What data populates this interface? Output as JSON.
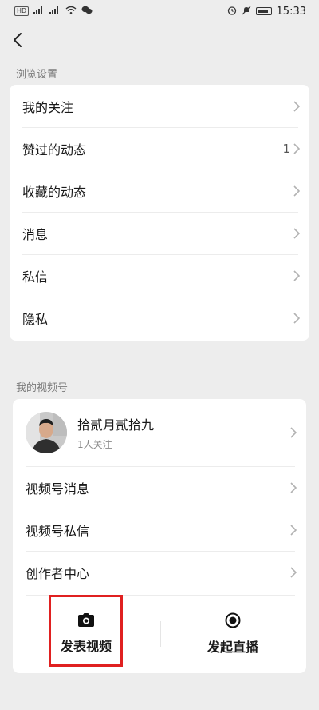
{
  "status_bar": {
    "left_badges": [
      "HD",
      "4G",
      "5G"
    ],
    "time": "15:33"
  },
  "browse_settings": {
    "section_title": "浏览设置",
    "items": [
      {
        "label": "我的关注",
        "value": ""
      },
      {
        "label": "赞过的动态",
        "value": "1"
      },
      {
        "label": "收藏的动态",
        "value": ""
      },
      {
        "label": "消息",
        "value": ""
      },
      {
        "label": "私信",
        "value": ""
      },
      {
        "label": "隐私",
        "value": ""
      }
    ]
  },
  "channels": {
    "section_title": "我的视频号",
    "profile": {
      "name": "拾贰月贰拾九",
      "follow_count": "1人关注"
    },
    "items": [
      {
        "label": "视频号消息"
      },
      {
        "label": "视频号私信"
      },
      {
        "label": "创作者中心"
      }
    ],
    "actions": [
      {
        "label": "发表视频",
        "icon": "camera-icon"
      },
      {
        "label": "发起直播",
        "icon": "live-record-icon"
      }
    ],
    "highlight_color": "#e02020"
  }
}
